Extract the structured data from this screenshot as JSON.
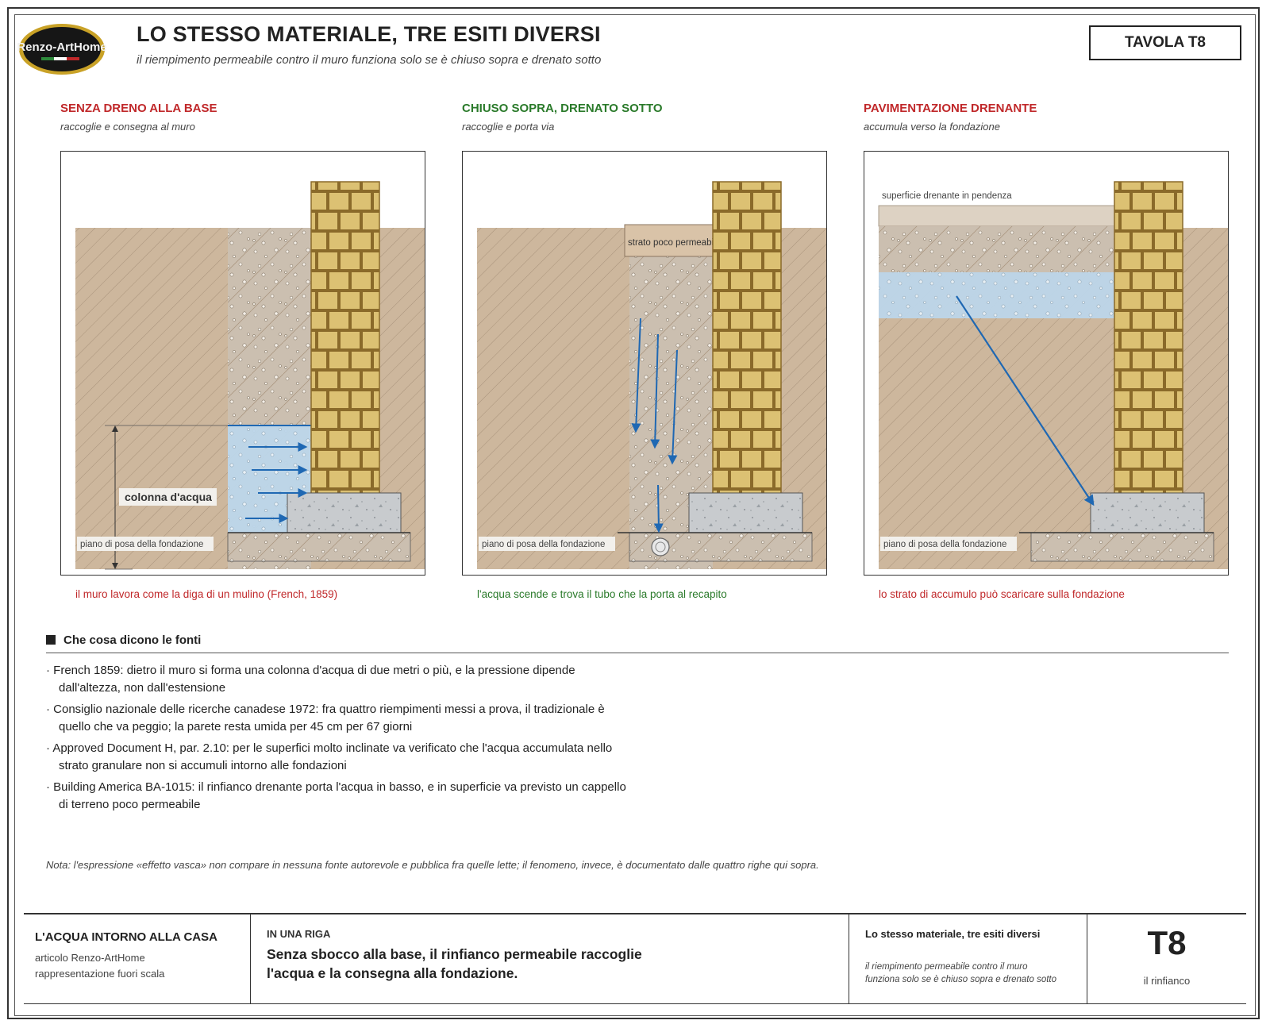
{
  "logo_text": "Renzo-ArtHome",
  "title": "LO STESSO MATERIALE, TRE ESITI DIVERSI",
  "subtitle": "il riempimento permeabile contro il muro funziona solo se è chiuso sopra e drenato sotto",
  "plate_label": "TAVOLA T8",
  "colors": {
    "red": "#c0282a",
    "green": "#2a7a2a",
    "soil": "#cdb79d",
    "brick": "#dcc173",
    "water": "#bcd6ea",
    "arrow": "#1f68b3",
    "concrete": "#c8cbce"
  },
  "panels": [
    {
      "heading": "SENZA DRENO ALLA BASE",
      "sub": "raccoglie e consegna al muro",
      "caption": "il muro lavora come la diga di un mulino (French, 1859)",
      "tone": "red",
      "label_water": "colonna d'acqua",
      "label_base": "piano di posa della fondazione"
    },
    {
      "heading": "CHIUSO SOPRA, DRENATO SOTTO",
      "sub": "raccoglie e porta via",
      "caption": "l'acqua scende e trova il tubo che la porta al recapito",
      "tone": "green",
      "label_cap": "strato poco permeabile",
      "label_base": "piano di posa della fondazione"
    },
    {
      "heading": "PAVIMENTAZIONE DRENANTE",
      "sub": "accumula verso la fondazione",
      "caption": "lo strato di accumulo può scaricare sulla fondazione",
      "tone": "red",
      "label_top": "superficie drenante in pendenza",
      "label_base": "piano di posa della fondazione"
    }
  ],
  "sources": {
    "heading": "Che cosa dicono le fonti",
    "items": [
      {
        "line1": "· French 1859: dietro il muro si forma una colonna d'acqua di due metri o più, e la pressione dipende",
        "line2": "dall'altezza, non dall'estensione"
      },
      {
        "line1": "· Consiglio nazionale delle ricerche canadese 1972: fra quattro riempimenti messi a prova, il tradizionale è",
        "line2": "quello che va peggio; la parete resta umida per 45 cm per 67 giorni"
      },
      {
        "line1": "· Approved Document H, par. 2.10: per le superfici molto inclinate va verificato che l'acqua accumulata nello",
        "line2": "strato granulare non si accumuli intorno alle fondazioni"
      },
      {
        "line1": "· Building America BA-1015: il rinfianco drenante porta l'acqua in basso, e in superficie va previsto un cappello",
        "line2": "di terreno poco permeabile"
      }
    ],
    "note": "Nota: l'espressione «effetto vasca» non compare in nessuna fonte autorevole e pubblica fra quelle lette; il fenomeno, invece, è documentato dalle quattro righe qui sopra."
  },
  "footer": {
    "series": "L'ACQUA INTORNO ALLA CASA",
    "article": "articolo Renzo-ArtHome",
    "scale": "rappresentazione fuori scala",
    "oneline_label": "IN UNA RIGA",
    "oneline_text": "Senza sbocco alla base, il rinfianco permeabile raccoglie l'acqua e la consegna alla fondazione.",
    "sheet_title": "Lo stesso materiale, tre esiti diversi",
    "sheet_sub": "il riempimento permeabile contro il muro funziona solo se è chiuso sopra e drenato sotto",
    "code": "T8",
    "code_sub": "il rinfianco"
  }
}
